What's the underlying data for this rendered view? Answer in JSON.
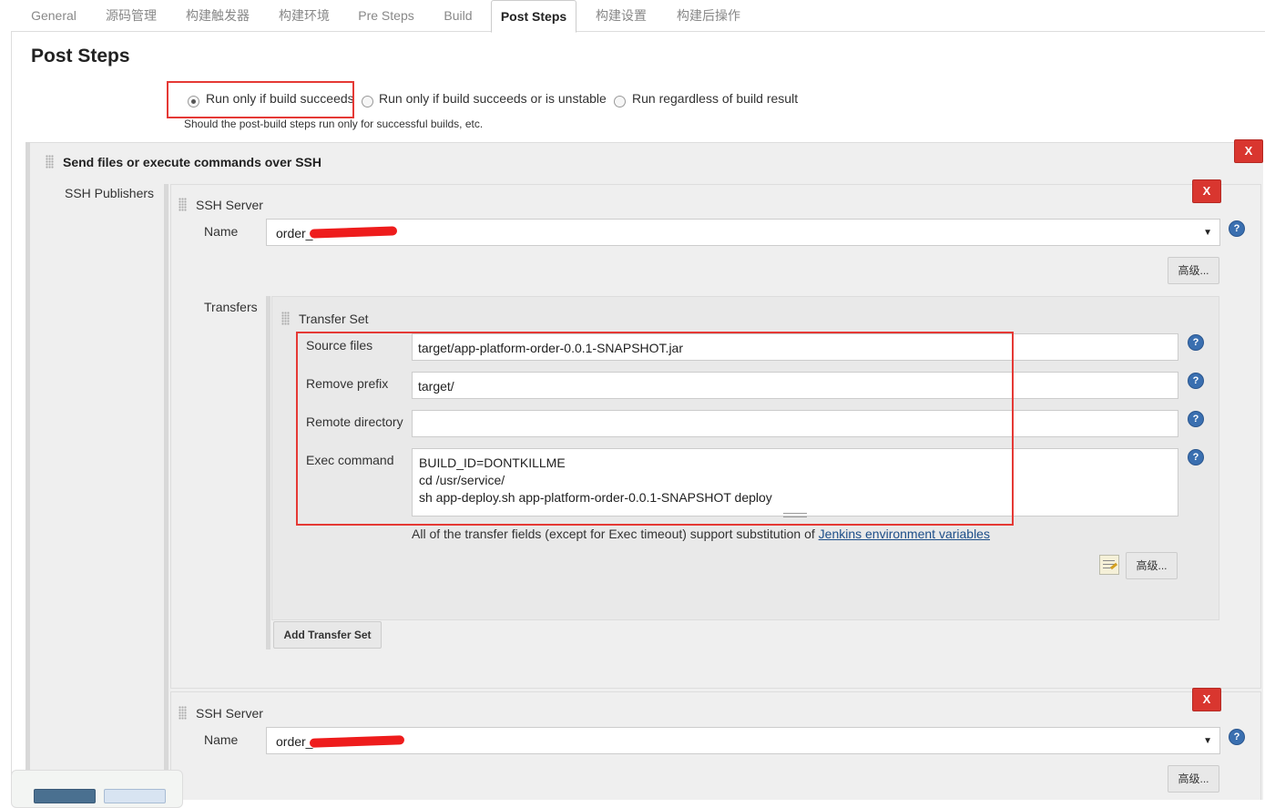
{
  "tabs": [
    {
      "label": "General"
    },
    {
      "label": "源码管理"
    },
    {
      "label": "构建触发器"
    },
    {
      "label": "构建环境"
    },
    {
      "label": "Pre Steps"
    },
    {
      "label": "Build"
    },
    {
      "label": "Post Steps"
    },
    {
      "label": "构建设置"
    },
    {
      "label": "构建后操作"
    }
  ],
  "active_tab": "Post Steps",
  "page_title": "Post Steps",
  "post_steps": {
    "options": [
      {
        "label": "Run only if build succeeds",
        "selected": true
      },
      {
        "label": "Run only if build succeeds or is unstable",
        "selected": false
      },
      {
        "label": "Run regardless of build result",
        "selected": false
      }
    ],
    "hint": "Should the post-build steps run only for successful builds, etc."
  },
  "builder": {
    "title": "Send files or execute commands over SSH",
    "delete_label": "X",
    "publishers_label": "SSH Publishers"
  },
  "server1": {
    "title": "SSH Server",
    "name_label": "Name",
    "name_value": "order_",
    "delete_label": "X",
    "advanced_label": "高级...",
    "transfers_label": "Transfers",
    "transfer_set": {
      "title": "Transfer Set",
      "source_files_label": "Source files",
      "source_files_value": "target/app-platform-order-0.0.1-SNAPSHOT.jar",
      "remove_prefix_label": "Remove prefix",
      "remove_prefix_value": "target/",
      "remote_directory_label": "Remote directory",
      "remote_directory_value": "",
      "exec_command_label": "Exec command",
      "exec_command_lines": [
        "BUILD_ID=DONTKILLME",
        "cd /usr/service/",
        "sh app-deploy.sh app-platform-order-0.0.1-SNAPSHOT deploy"
      ],
      "note_text": "All of the transfer fields (except for Exec timeout) support substitution of ",
      "note_link": "Jenkins environment variables",
      "advanced_label": "高级..."
    },
    "add_transfer_label": "Add Transfer Set"
  },
  "server2": {
    "title": "SSH Server",
    "name_label": "Name",
    "name_value": "order_",
    "delete_label": "X",
    "advanced_label": "高级..."
  },
  "colors": {
    "accent_red": "#d9362f",
    "annotation_red": "#e53935",
    "help_blue": "#3a6fb0",
    "link_blue": "#1d4e89"
  }
}
